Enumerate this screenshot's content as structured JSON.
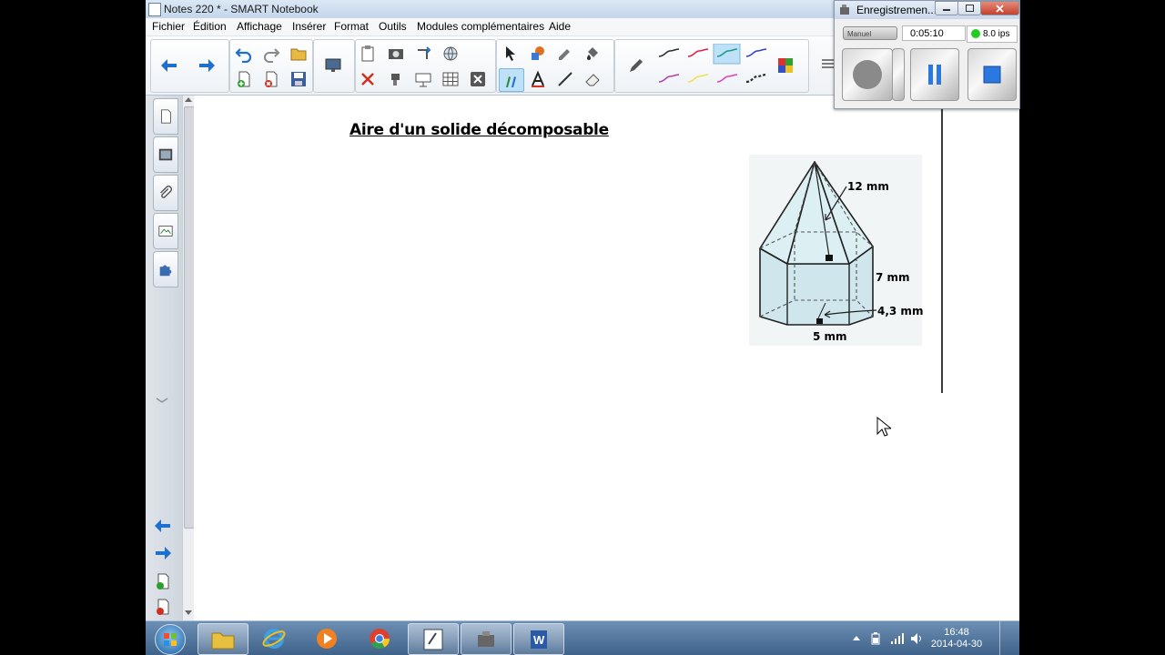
{
  "window": {
    "title": "Notes 220 * - SMART Notebook"
  },
  "menu": [
    "Fichier",
    "Édition",
    "Affichage",
    "Insérer",
    "Format",
    "Outils",
    "Modules complémentaires",
    "Aide"
  ],
  "page": {
    "title": "Aire d'un solide décomposable",
    "figure": {
      "labels": {
        "slant": "12 mm",
        "height": "7 mm",
        "apothem": "4,3 mm",
        "side": "5 mm"
      }
    }
  },
  "recorder": {
    "title": "Enregistremen...",
    "mode": "Manuel",
    "elapsed": "0:05:10",
    "fps": "8.0 ips",
    "status_color": "#22cc22"
  },
  "taskbar": {
    "time": "16:48",
    "date": "2014-04-30"
  },
  "colors": {
    "accent_selected": "#bfe1f7",
    "taskbar": "#4b6e96",
    "pen_colors": [
      "#2b2b2b",
      "#e02040",
      "#1a9a8a",
      "#3040c0",
      "#b040b0",
      "#f0e050",
      "#e040c0",
      "#2b2b2b"
    ]
  }
}
